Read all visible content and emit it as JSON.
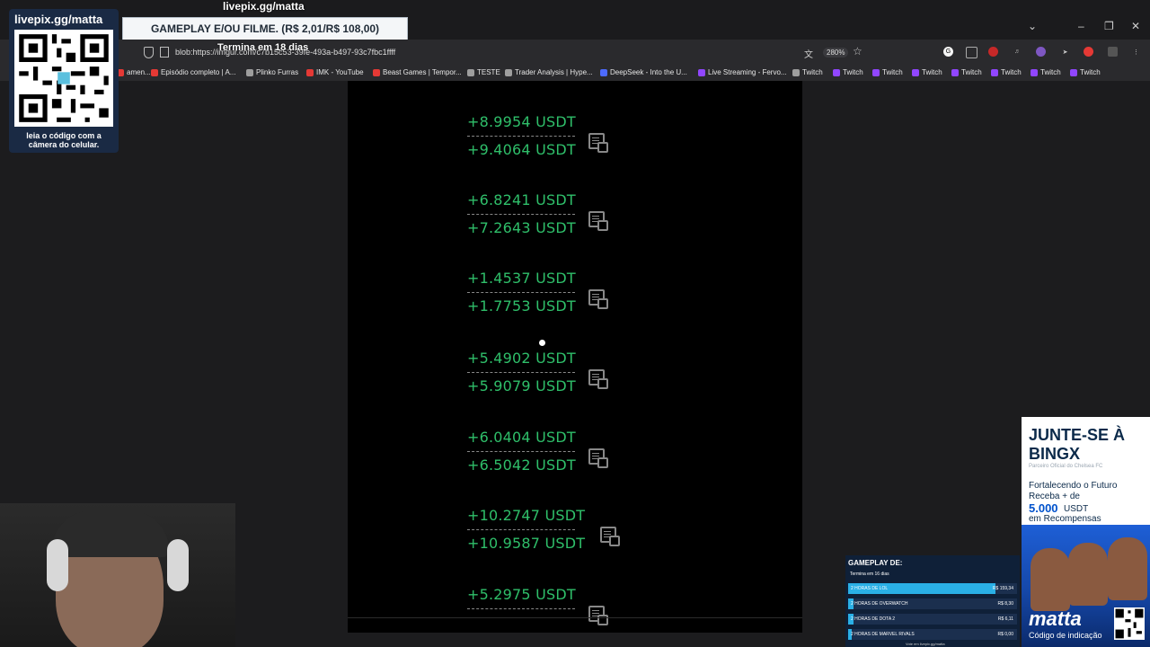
{
  "overlay": {
    "channel": "livepix.gg/matta",
    "pix_banner": "GAMEPLAY E/OU FILME. (R$ 2,01/R$ 108,00)",
    "pix_subtitle": "Termina em 18 dias",
    "qr_caption": "leia o código com a câmera do celular."
  },
  "browser": {
    "url": "blob:https://imgur.com/c7b15c53-39fe-493a-b497-93c7fbc1ffff",
    "zoom": "280%",
    "bookmarks": [
      {
        "label": "amen...",
        "color": "#e53935"
      },
      {
        "label": "Episódio completo | A...",
        "color": "#e53935"
      },
      {
        "label": "Plinko Furras",
        "color": "#9e9e9e"
      },
      {
        "label": "IMK - YouTube",
        "color": "#e53935"
      },
      {
        "label": "Beast Games | Tempor...",
        "color": "#e53935"
      },
      {
        "label": "TESTE",
        "color": "#9e9e9e"
      },
      {
        "label": "Trader Analysis | Hype...",
        "color": "#9e9e9e"
      },
      {
        "label": "DeepSeek - Into the U...",
        "color": "#4d6bfe"
      },
      {
        "label": "Live Streaming - Fervo...",
        "color": "#9146ff"
      },
      {
        "label": "Twitch",
        "color": "#9e9e9e"
      },
      {
        "label": "Twitch",
        "color": "#9146ff"
      },
      {
        "label": "Twitch",
        "color": "#9146ff"
      },
      {
        "label": "Twitch",
        "color": "#9146ff"
      },
      {
        "label": "Twitch",
        "color": "#9146ff"
      },
      {
        "label": "Twitch",
        "color": "#9146ff"
      },
      {
        "label": "Twitch",
        "color": "#9146ff"
      },
      {
        "label": "Twitch",
        "color": "#9146ff"
      }
    ]
  },
  "entries": [
    {
      "top": "+8.9954 USDT",
      "bottom": "+9.4064 USDT"
    },
    {
      "top": "+6.8241 USDT",
      "bottom": "+7.2643 USDT"
    },
    {
      "top": "+1.4537 USDT",
      "bottom": "+1.7753 USDT"
    },
    {
      "top": "+5.4902 USDT",
      "bottom": "+5.9079 USDT"
    },
    {
      "top": "+6.0404 USDT",
      "bottom": "+6.5042 USDT"
    },
    {
      "top": "+10.2747 USDT",
      "bottom": "+10.9587 USDT"
    },
    {
      "top": "+5.2975 USDT",
      "bottom": ""
    }
  ],
  "ad": {
    "headline": "JUNTE-SE À BINGX",
    "partner": "Parceiro Oficial do Chelsea FC",
    "line1": "Fortalecendo o Futuro Receba + de",
    "amount": "5.000",
    "unit": "USDT",
    "line2": "em Recompensas",
    "brand": "matta",
    "brand_sub": "Código de indicação"
  },
  "gameplay": {
    "title": "GAMEPLAY DE:",
    "subtitle": "Termina em 16 dias",
    "items": [
      {
        "label": "2 HORAS DE LOL",
        "price": "R$ 159,34",
        "progress": 0.87
      },
      {
        "label": "2 HORAS DE OVERWATCH",
        "price": "R$ 8,30",
        "progress": 0.03
      },
      {
        "label": "2 HORAS DE DOTA 2",
        "price": "R$ 6,11",
        "progress": 0.03
      },
      {
        "label": "2 HORAS DE MARVEL RIVALS",
        "price": "R$ 0,00",
        "progress": 0.0
      }
    ],
    "footer": "Vote em livepix.gg/matta"
  }
}
